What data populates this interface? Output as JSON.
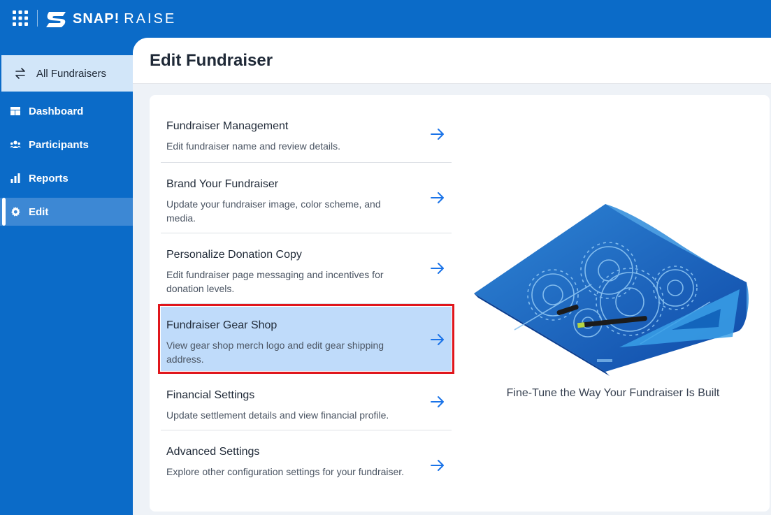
{
  "brand": {
    "name_bold": "SNAP!",
    "name_light": "RAISE",
    "primary_color": "#0b6bc8",
    "highlight_color": "#bfdbfa",
    "outline_color": "#e0161c"
  },
  "sidebar": {
    "all_fundraisers_label": "All Fundraisers",
    "items": [
      {
        "label": "Dashboard",
        "icon": "dashboard-icon"
      },
      {
        "label": "Participants",
        "icon": "users-icon"
      },
      {
        "label": "Reports",
        "icon": "bar-chart-icon"
      },
      {
        "label": "Edit",
        "icon": "gear-icon",
        "active": true
      }
    ]
  },
  "main": {
    "title": "Edit Fundraiser",
    "menu": [
      {
        "title": "Fundraiser Management",
        "description": "Edit fundraiser name and review details."
      },
      {
        "title": "Brand Your Fundraiser",
        "description": "Update your fundraiser image, color scheme, and media."
      },
      {
        "title": "Personalize Donation Copy",
        "description": "Edit fundraiser page messaging and incentives for donation levels."
      },
      {
        "title": "Fundraiser Gear Shop",
        "description": "View gear shop merch logo and edit gear shipping address.",
        "highlighted": true
      },
      {
        "title": "Financial Settings",
        "description": "Update settlement details and view financial profile."
      },
      {
        "title": "Advanced Settings",
        "description": "Explore other configuration settings for your fundraiser."
      }
    ],
    "illustration_caption": "Fine-Tune the Way Your Fundraiser Is Built"
  }
}
